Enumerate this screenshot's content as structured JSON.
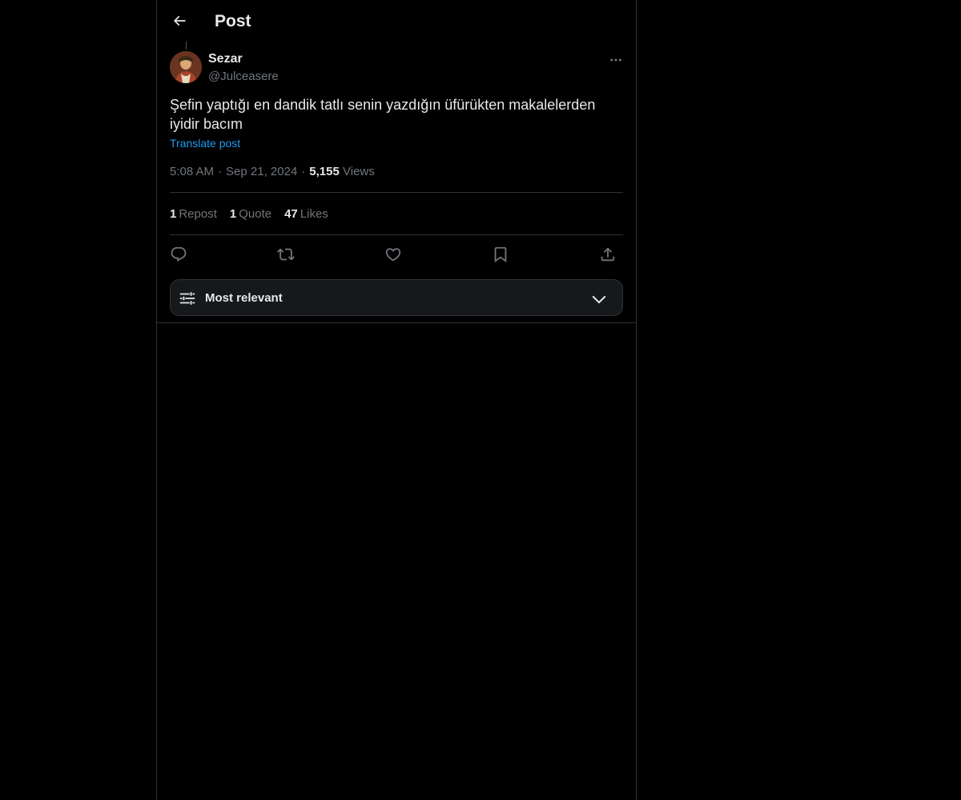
{
  "header": {
    "title": "Post",
    "back_icon": "arrow-left-icon"
  },
  "author": {
    "name": "Sezar",
    "handle": "@Julceasere",
    "avatar_icon": "avatar"
  },
  "post": {
    "text": "Şefin yaptığı en dandik tatlı senin yazdığın üfürükten makalelerden iyidir bacım",
    "translate_label": "Translate post",
    "time": "5:08 AM",
    "date": "Sep 21, 2024",
    "separator": "·",
    "views_count": "5,155",
    "views_label": "Views"
  },
  "stats": {
    "reposts_count": "1",
    "reposts_label": "Repost",
    "quotes_count": "1",
    "quotes_label": "Quote",
    "likes_count": "47",
    "likes_label": "Likes"
  },
  "actions": {
    "reply_icon": "reply-icon",
    "repost_icon": "repost-icon",
    "like_icon": "heart-icon",
    "bookmark_icon": "bookmark-icon",
    "share_icon": "share-icon"
  },
  "sort": {
    "label": "Most relevant",
    "icon": "sliders-icon",
    "chevron": "chevron-down-icon"
  },
  "colors": {
    "background": "#000000",
    "text_primary": "#e7e9ea",
    "text_secondary": "#71767b",
    "accent": "#1d9bf0",
    "border": "#2f3336"
  }
}
